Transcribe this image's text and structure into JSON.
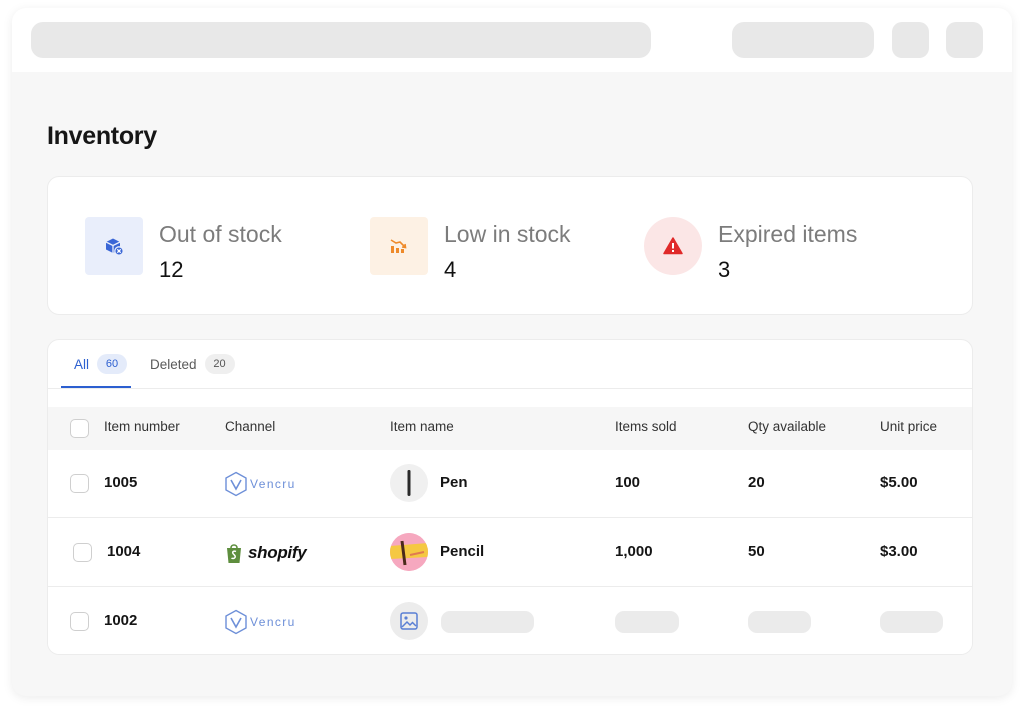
{
  "page": {
    "title": "Inventory"
  },
  "stats": [
    {
      "label": "Out of stock",
      "value": "12",
      "icon": "box-icon",
      "color": "#3a66d6"
    },
    {
      "label": "Low in stock",
      "value": "4",
      "icon": "chart-decline-icon",
      "color": "#ee8a2a"
    },
    {
      "label": "Expired items",
      "value": "3",
      "icon": "warning-icon",
      "color": "#e02a2a"
    }
  ],
  "tabs": [
    {
      "label": "All",
      "count": "60",
      "active": true
    },
    {
      "label": "Deleted",
      "count": "20",
      "active": false
    }
  ],
  "table": {
    "columns": [
      "Item number",
      "Channel",
      "Item name",
      "Items sold",
      "Qty available",
      "Unit price"
    ],
    "rows": [
      {
        "item_number": "1005",
        "channel": "Vencru",
        "item_name": "Pen",
        "items_sold": "100",
        "qty_available": "20",
        "unit_price": "$5.00"
      },
      {
        "item_number": "1004",
        "channel": "shopify",
        "item_name": "Pencil",
        "items_sold": "1,000",
        "qty_available": "50",
        "unit_price": "$3.00"
      },
      {
        "item_number": "1002",
        "channel": "Vencru",
        "item_name": "",
        "items_sold": "",
        "qty_available": "",
        "unit_price": ""
      }
    ]
  },
  "colors": {
    "accent": "#2c5fd0",
    "vencru": "#6d8fd8",
    "shopify": "#5e8e3e"
  }
}
